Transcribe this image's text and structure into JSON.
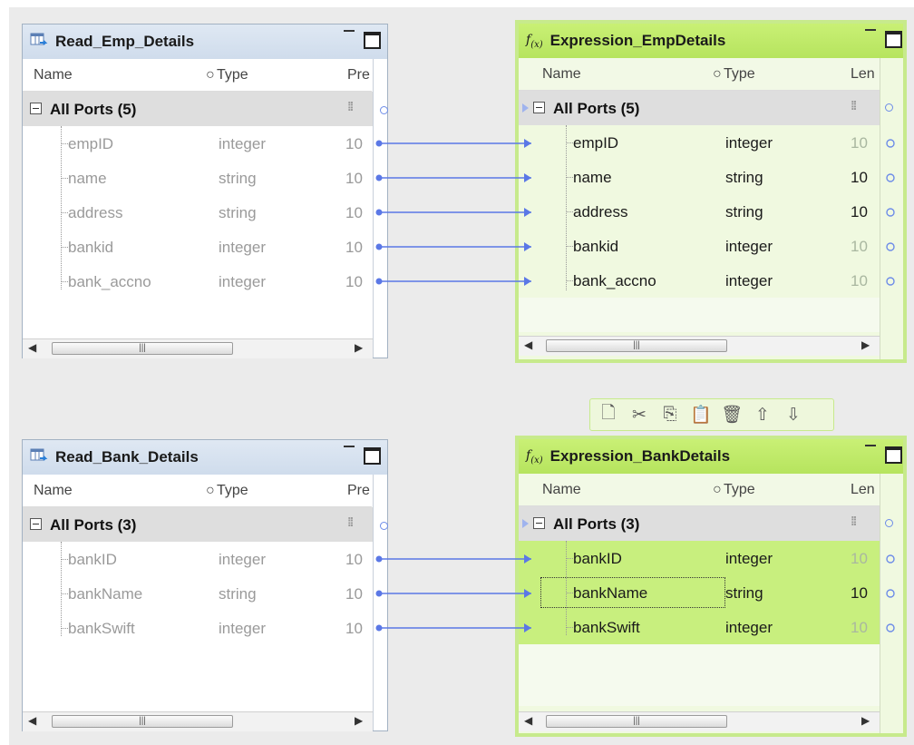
{
  "columns": {
    "name": "Name",
    "type": "Type",
    "precision": "Pre",
    "length": "Len"
  },
  "widgets": {
    "read_emp": {
      "title": "Read_Emp_Details",
      "all_ports": "All Ports (5)",
      "ports": [
        {
          "name": "empID",
          "type": "integer",
          "prec": "10"
        },
        {
          "name": "name",
          "type": "string",
          "prec": "10"
        },
        {
          "name": "address",
          "type": "string",
          "prec": "10"
        },
        {
          "name": "bankid",
          "type": "integer",
          "prec": "10"
        },
        {
          "name": "bank_accno",
          "type": "integer",
          "prec": "10"
        }
      ]
    },
    "expr_emp": {
      "title": "Expression_EmpDetails",
      "all_ports": "All Ports (5)",
      "ports": [
        {
          "name": "empID",
          "type": "integer",
          "len": "10"
        },
        {
          "name": "name",
          "type": "string",
          "len": "10"
        },
        {
          "name": "address",
          "type": "string",
          "len": "10"
        },
        {
          "name": "bankid",
          "type": "integer",
          "len": "10"
        },
        {
          "name": "bank_accno",
          "type": "integer",
          "len": "10"
        }
      ]
    },
    "read_bank": {
      "title": "Read_Bank_Details",
      "all_ports": "All Ports (3)",
      "ports": [
        {
          "name": "bankID",
          "type": "integer",
          "prec": "10"
        },
        {
          "name": "bankName",
          "type": "string",
          "prec": "10"
        },
        {
          "name": "bankSwift",
          "type": "integer",
          "prec": "10"
        }
      ]
    },
    "expr_bank": {
      "title": "Expression_BankDetails",
      "all_ports": "All Ports (3)",
      "ports": [
        {
          "name": "bankID",
          "type": "integer",
          "len": "10"
        },
        {
          "name": "bankName",
          "type": "string",
          "len": "10"
        },
        {
          "name": "bankSwift",
          "type": "integer",
          "len": "10"
        }
      ]
    }
  },
  "toolbar": {
    "buttons": [
      "new-port-icon",
      "cut-icon",
      "copy-icon",
      "paste-icon",
      "delete-icon",
      "move-up-icon",
      "move-down-icon"
    ]
  },
  "colors": {
    "canvas": "#ebebeb",
    "source_title": "#cfdcec",
    "expression_title": "#b6e45e",
    "expression_border": "#c7ea8c",
    "link": "#5b78e6"
  }
}
